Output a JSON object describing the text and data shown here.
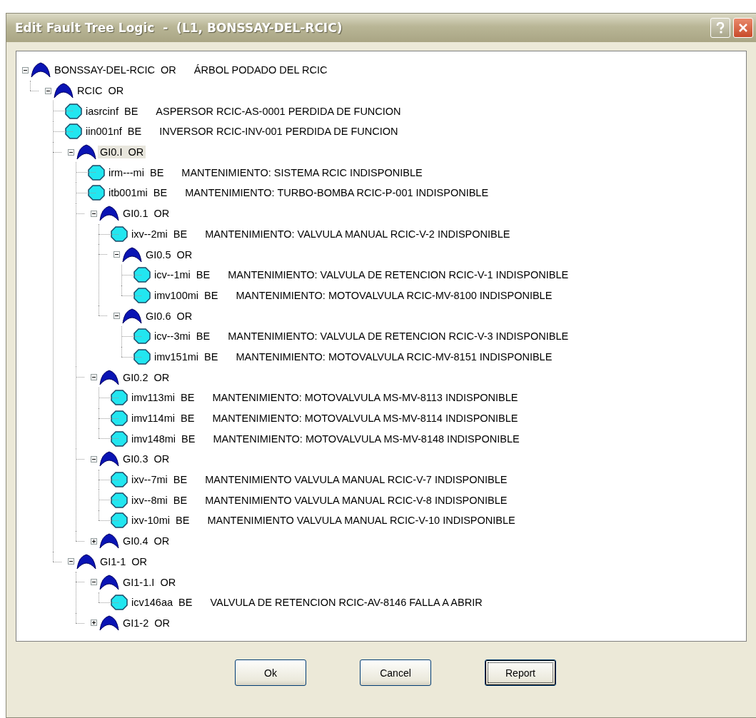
{
  "window": {
    "title": "Edit Fault Tree Logic  -  (L1, BONSSAY-DEL-RCIC)"
  },
  "tree": [
    {
      "kind": "gate",
      "name": "BONSSAY-DEL-RCIC",
      "type": "OR",
      "description": "ÁRBOL PODADO DEL RCIC",
      "expanded": true,
      "selected": false,
      "children": [
        {
          "kind": "gate",
          "name": "RCIC",
          "type": "OR",
          "expanded": true,
          "selected": false,
          "children": [
            {
              "kind": "event",
              "name": "iasrcinf",
              "type": "BE",
              "description": "ASPERSOR RCIC-AS-0001 PERDIDA DE FUNCION",
              "selected": false
            },
            {
              "kind": "event",
              "name": "iin001nf",
              "type": "BE",
              "description": "INVERSOR RCIC-INV-001 PERDIDA DE FUNCION",
              "selected": false
            },
            {
              "kind": "gate",
              "name": "GI0.I",
              "type": "OR",
              "expanded": true,
              "selected": true,
              "children": [
                {
                  "kind": "event",
                  "name": "irm---mi",
                  "type": "BE",
                  "description": "MANTENIMIENTO: SISTEMA RCIC INDISPONIBLE",
                  "selected": false
                },
                {
                  "kind": "event",
                  "name": "itb001mi",
                  "type": "BE",
                  "description": "MANTENIMIENTO: TURBO-BOMBA RCIC-P-001 INDISPONIBLE",
                  "selected": false
                },
                {
                  "kind": "gate",
                  "name": "GI0.1",
                  "type": "OR",
                  "expanded": true,
                  "selected": false,
                  "children": [
                    {
                      "kind": "event",
                      "name": "ixv--2mi",
                      "type": "BE",
                      "description": "MANTENIMIENTO: VALVULA MANUAL RCIC-V-2 INDISPONIBLE",
                      "selected": false
                    },
                    {
                      "kind": "gate",
                      "name": "GI0.5",
                      "type": "OR",
                      "expanded": true,
                      "selected": false,
                      "children": [
                        {
                          "kind": "event",
                          "name": "icv--1mi",
                          "type": "BE",
                          "description": "MANTENIMIENTO: VALVULA DE RETENCION RCIC-V-1 INDISPONIBLE",
                          "selected": false
                        },
                        {
                          "kind": "event",
                          "name": "imv100mi",
                          "type": "BE",
                          "description": "MANTENIMIENTO: MOTOVALVULA RCIC-MV-8100 INDISPONIBLE",
                          "selected": false
                        }
                      ]
                    },
                    {
                      "kind": "gate",
                      "name": "GI0.6",
                      "type": "OR",
                      "expanded": true,
                      "selected": false,
                      "children": [
                        {
                          "kind": "event",
                          "name": "icv--3mi",
                          "type": "BE",
                          "description": "MANTENIMIENTO: VALVULA DE RETENCION RCIC-V-3 INDISPONIBLE",
                          "selected": false
                        },
                        {
                          "kind": "event",
                          "name": "imv151mi",
                          "type": "BE",
                          "description": "MANTENIMIENTO: MOTOVALVULA RCIC-MV-8151 INDISPONIBLE",
                          "selected": false
                        }
                      ]
                    }
                  ]
                },
                {
                  "kind": "gate",
                  "name": "GI0.2",
                  "type": "OR",
                  "expanded": true,
                  "selected": false,
                  "children": [
                    {
                      "kind": "event",
                      "name": "imv113mi",
                      "type": "BE",
                      "description": "MANTENIMIENTO: MOTOVALVULA MS-MV-8113 INDISPONIBLE",
                      "selected": false
                    },
                    {
                      "kind": "event",
                      "name": "imv114mi",
                      "type": "BE",
                      "description": "MANTENIMIENTO: MOTOVALVULA MS-MV-8114 INDISPONIBLE",
                      "selected": false
                    },
                    {
                      "kind": "event",
                      "name": "imv148mi",
                      "type": "BE",
                      "description": "MANTENIMIENTO: MOTOVALVULA MS-MV-8148 INDISPONIBLE",
                      "selected": false
                    }
                  ]
                },
                {
                  "kind": "gate",
                  "name": "GI0.3",
                  "type": "OR",
                  "expanded": true,
                  "selected": false,
                  "children": [
                    {
                      "kind": "event",
                      "name": "ixv--7mi",
                      "type": "BE",
                      "description": "MANTENIMIENTO VALVULA MANUAL RCIC-V-7 INDISPONIBLE",
                      "selected": false
                    },
                    {
                      "kind": "event",
                      "name": "ixv--8mi",
                      "type": "BE",
                      "description": "MANTENIMIENTO VALVULA MANUAL RCIC-V-8 INDISPONIBLE",
                      "selected": false
                    },
                    {
                      "kind": "event",
                      "name": "ixv-10mi",
                      "type": "BE",
                      "description": "MANTENIMIENTO VALVULA MANUAL RCIC-V-10 INDISPONIBLE",
                      "selected": false
                    }
                  ]
                },
                {
                  "kind": "gate",
                  "name": "GI0.4",
                  "type": "OR",
                  "expanded": false,
                  "selected": false
                }
              ]
            },
            {
              "kind": "gate",
              "name": "GI1-1",
              "type": "OR",
              "expanded": true,
              "selected": false,
              "children": [
                {
                  "kind": "gate",
                  "name": "GI1-1.I",
                  "type": "OR",
                  "expanded": true,
                  "selected": false,
                  "children": [
                    {
                      "kind": "event",
                      "name": "icv146aa",
                      "type": "BE",
                      "description": "VALVULA DE RETENCION RCIC-AV-8146 FALLA A ABRIR",
                      "selected": false
                    }
                  ]
                },
                {
                  "kind": "gate",
                  "name": "GI1-2",
                  "type": "OR",
                  "expanded": false,
                  "selected": false
                }
              ]
            }
          ]
        }
      ]
    }
  ],
  "buttons": [
    {
      "label": "Ok",
      "focused": false
    },
    {
      "label": "Cancel",
      "focused": false
    },
    {
      "label": "Report",
      "focused": true
    }
  ]
}
